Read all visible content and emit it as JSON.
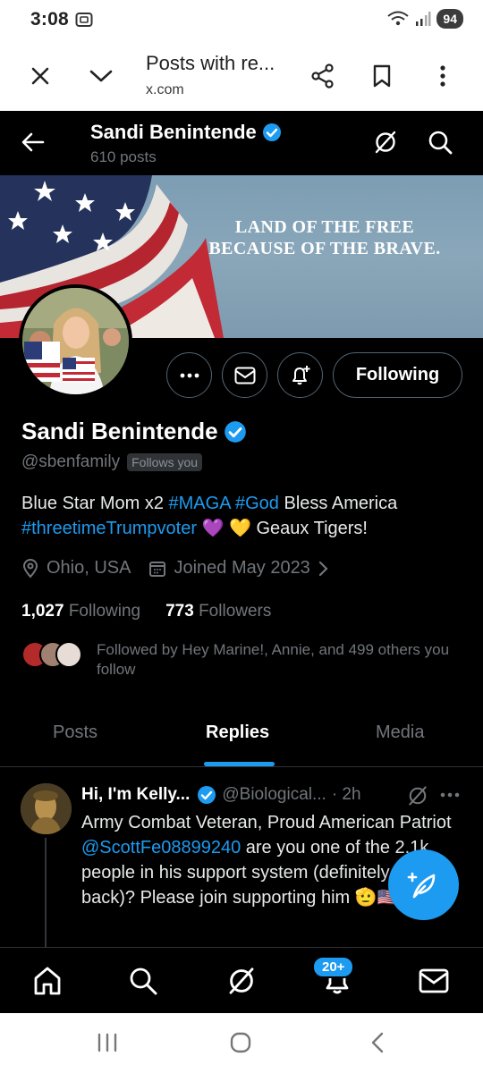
{
  "status_bar": {
    "time": "3:08",
    "battery": "94"
  },
  "browser": {
    "title": "Posts with re...",
    "url": "x.com"
  },
  "header": {
    "name": "Sandi Benintende",
    "post_count": "610 posts"
  },
  "banner": {
    "line1": "LAND OF THE FREE",
    "line2": "BECAUSE OF THE BRAVE."
  },
  "actions": {
    "following_label": "Following"
  },
  "profile": {
    "name": "Sandi Benintende",
    "handle": "@sbenfamily",
    "follows_you": "Follows you",
    "bio": {
      "t1": "Blue Star Mom x2 ",
      "tag1": "#MAGA",
      "t2": " ",
      "tag2": "#God",
      "t3": " Bless America",
      "tag3": "#threetimeTrumpvoter",
      "t4": " 💜 💛 Geaux Tigers!"
    },
    "location": "Ohio, USA",
    "joined": "Joined May 2023",
    "following_count": "1,027",
    "following_label": "Following",
    "followers_count": "773",
    "followers_label": "Followers",
    "followed_by": "Followed by Hey Marine!, Annie, and 499 others you follow"
  },
  "tabs": [
    "Posts",
    "Replies",
    "Media"
  ],
  "post": {
    "author": "Hi, I'm Kelly...",
    "handle": "@Biological...",
    "time": "· 2h",
    "text1": "Army Combat Veteran, Proud American Patriot ",
    "mention": "@ScottFe08899240",
    "text2": " are you one of the 2.1k people in his support system (definitely follows back)? Please join supporting him 🫡🇺🇸"
  },
  "bottom_nav": {
    "notifications_badge": "20+"
  },
  "colors": {
    "accent": "#1d9bf0",
    "background": "#000000",
    "muted": "#71767b"
  }
}
